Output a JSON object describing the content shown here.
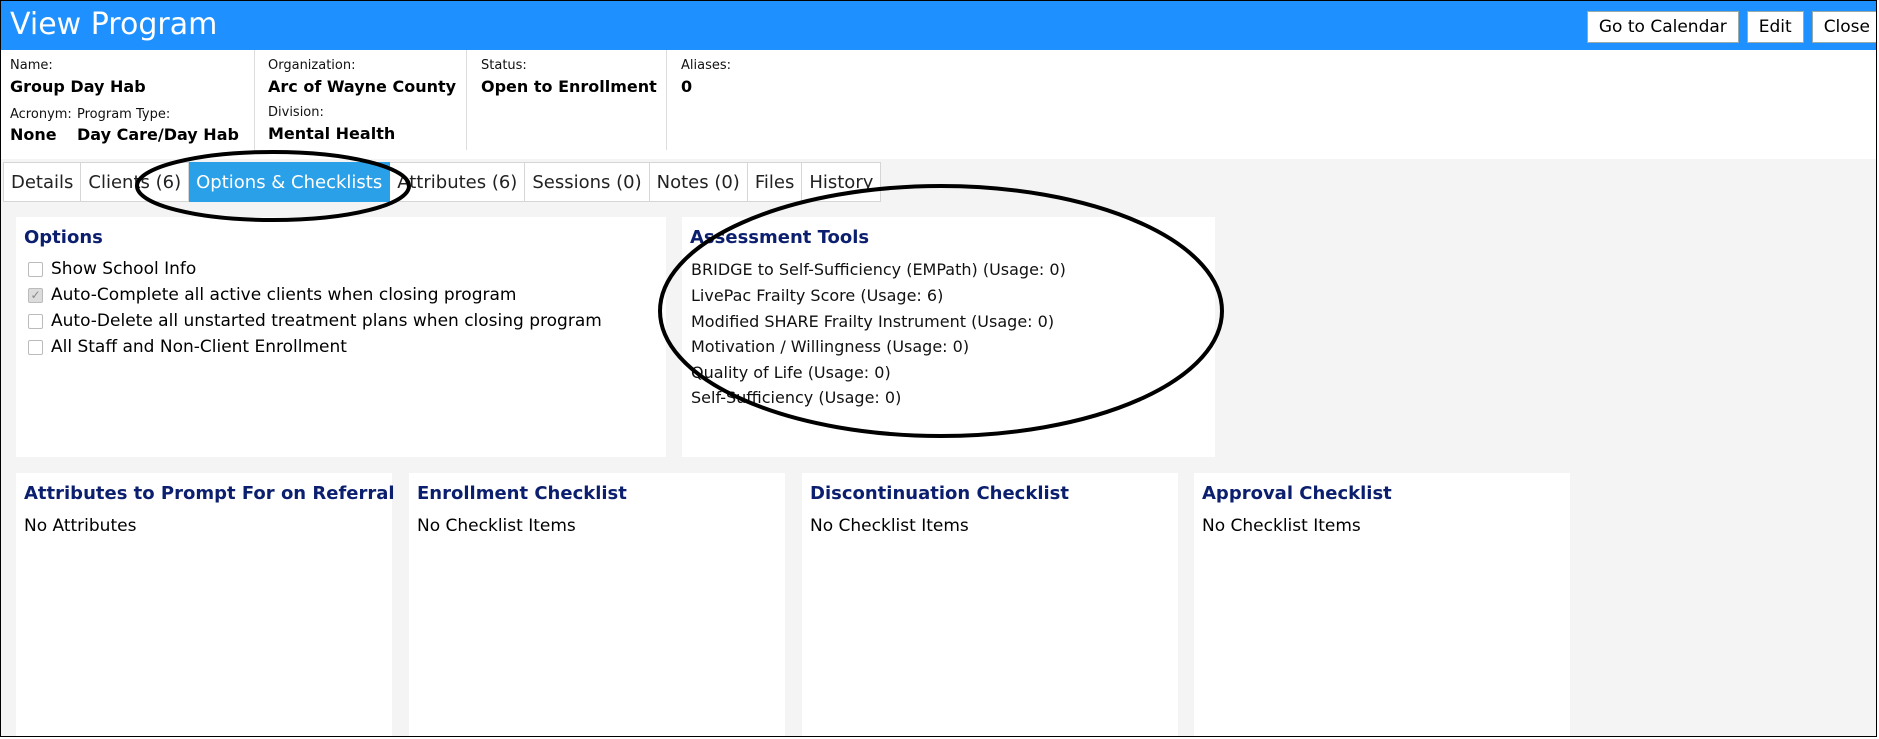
{
  "header": {
    "title": "View Program",
    "buttons": {
      "calendar": "Go to Calendar",
      "edit": "Edit",
      "close": "Close"
    },
    "accent_color": "#1e90ff"
  },
  "info": {
    "name_label": "Name:",
    "name_value": "Group Day Hab",
    "acronym_label": "Acronym:",
    "acronym_value": "None",
    "program_type_label": "Program Type:",
    "program_type_value": "Day Care/Day Hab",
    "organization_label": "Organization:",
    "organization_value": "Arc of Wayne County",
    "division_label": "Division:",
    "division_value": "Mental Health",
    "status_label": "Status:",
    "status_value": "Open to Enrollment",
    "aliases_label": "Aliases:",
    "aliases_value": "0"
  },
  "tabs": [
    {
      "label": "Details"
    },
    {
      "label": "Clients (6)"
    },
    {
      "label": "Options & Checklists",
      "active": true
    },
    {
      "label": "Attributes (6)"
    },
    {
      "label": "Sessions (0)"
    },
    {
      "label": "Notes (0)"
    },
    {
      "label": "Files"
    },
    {
      "label": "History"
    }
  ],
  "options": {
    "title": "Options",
    "items": [
      {
        "label": "Show School Info",
        "checked": false
      },
      {
        "label": "Auto-Complete all active clients when closing program",
        "checked": true
      },
      {
        "label": "Auto-Delete all unstarted treatment plans when closing program",
        "checked": false
      },
      {
        "label": "All Staff and Non-Client Enrollment",
        "checked": false
      }
    ]
  },
  "assessment_tools": {
    "title": "Assessment Tools",
    "items": [
      "BRIDGE to Self-Sufficiency (EMPath) (Usage: 0)",
      "LivePac Frailty Score (Usage: 6)",
      "Modified SHARE Frailty Instrument (Usage: 0)",
      "Motivation / Willingness (Usage: 0)",
      "Quality of Life (Usage: 0)",
      "Self-Sufficiency (Usage: 0)"
    ]
  },
  "checklists": {
    "referral": {
      "title": "Attributes to Prompt For on Referral",
      "empty": "No Attributes"
    },
    "enrollment": {
      "title": "Enrollment Checklist",
      "empty": "No Checklist Items"
    },
    "discontinuation": {
      "title": "Discontinuation Checklist",
      "empty": "No Checklist Items"
    },
    "approval": {
      "title": "Approval Checklist",
      "empty": "No Checklist Items"
    }
  }
}
